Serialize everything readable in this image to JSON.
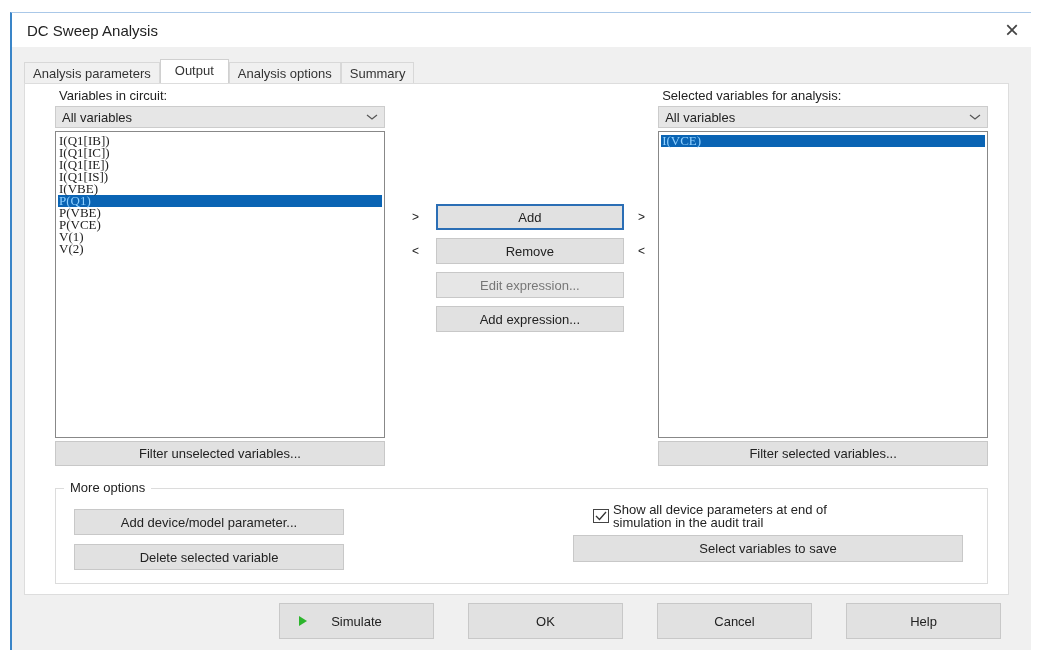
{
  "window": {
    "title": "DC Sweep Analysis",
    "close": "×"
  },
  "tabs": [
    {
      "label": "Analysis parameters",
      "selected": false
    },
    {
      "label": "Output",
      "selected": true
    },
    {
      "label": "Analysis options",
      "selected": false
    },
    {
      "label": "Summary",
      "selected": false
    }
  ],
  "circuit_variables": {
    "label": "Variables in circuit:",
    "filter": "All variables",
    "items": [
      {
        "text": "I(Q1[IB])",
        "selected": false
      },
      {
        "text": "I(Q1[IC])",
        "selected": false
      },
      {
        "text": "I(Q1[IE])",
        "selected": false
      },
      {
        "text": "I(Q1[IS])",
        "selected": false
      },
      {
        "text": "I(VBE)",
        "selected": false
      },
      {
        "text": "P(Q1)",
        "selected": true
      },
      {
        "text": "P(VBE)",
        "selected": false
      },
      {
        "text": "P(VCE)",
        "selected": false
      },
      {
        "text": "V(1)",
        "selected": false
      },
      {
        "text": "V(2)",
        "selected": false
      }
    ],
    "filter_button": "Filter unselected variables..."
  },
  "transfer_buttons": [
    {
      "label": "Add",
      "left_mark": ">",
      "right_mark": ">",
      "focused": true,
      "disabled": false
    },
    {
      "label": "Remove",
      "left_mark": "<",
      "right_mark": "<",
      "focused": false,
      "disabled": false
    },
    {
      "label": "Edit expression...",
      "focused": false,
      "disabled": true
    },
    {
      "label": "Add expression...",
      "focused": false,
      "disabled": false
    }
  ],
  "analysis_variables": {
    "label": "Selected variables for analysis:",
    "filter": "All variables",
    "items": [
      {
        "text": "I(VCE)",
        "selected": true
      }
    ],
    "filter_button": "Filter selected variables..."
  },
  "more_options": {
    "title": "More options",
    "add_parameter": "Add device/model parameter...",
    "delete_variable": "Delete selected variable",
    "show_parameters": {
      "label": "Show all device parameters at end of simulation in the audit trail",
      "checked": true
    },
    "save_button": "Select variables to save"
  },
  "footer_buttons": [
    {
      "label": "Simulate",
      "kind": "run"
    },
    {
      "label": "OK",
      "kind": "plain"
    },
    {
      "label": "Cancel",
      "kind": "plain"
    },
    {
      "label": "Help",
      "kind": "plain"
    }
  ]
}
